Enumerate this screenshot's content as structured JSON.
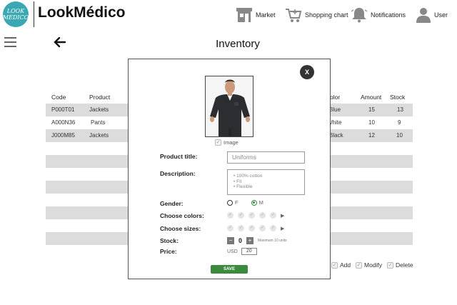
{
  "brand": {
    "logo_line1": "LOOK",
    "logo_line2": "MEDICO",
    "name": "LookMédico"
  },
  "nav": {
    "market": "Market",
    "cart": "Shopping chart",
    "notifications": "Notifications",
    "user": "User"
  },
  "page": {
    "title": "Inventory"
  },
  "table": {
    "headers": {
      "code": "Code",
      "product": "Product",
      "color": "olor",
      "amount": "Amount",
      "stock": "Stock"
    },
    "rows": [
      {
        "code": "P000T01",
        "product": "Jackets",
        "color": "Blue",
        "amount": "15",
        "stock": "13"
      },
      {
        "code": "A000N36",
        "product": "Pants",
        "color": "White",
        "amount": "10",
        "stock": "9"
      },
      {
        "code": "J000M85",
        "product": "Jackets",
        "color": "Black",
        "amount": "12",
        "stock": "10"
      }
    ]
  },
  "actions": {
    "add": "Add",
    "modify": "Modify",
    "delete": "Delete"
  },
  "modal": {
    "close_label": "X",
    "image_caption": "Image",
    "product_title_label": "Product title:",
    "product_title_value": "Uniforms",
    "description_label": "Description:",
    "description_lines": [
      "100% cotton",
      "Fit",
      "Flexible"
    ],
    "gender_label": "Gender:",
    "gender_f": "F",
    "gender_m": "M",
    "colors_label": "Choose colors:",
    "sizes_label": "Choose sizes:",
    "stock_label": "Stock:",
    "stock_minus": "−",
    "stock_value": "0",
    "stock_plus": "+",
    "stock_hint": "Maximum 10 units",
    "price_label": "Price:",
    "price_currency": "USD",
    "price_value": "20",
    "save_label": "SAVE"
  },
  "colors": {
    "accent_teal": "#3aa8b3",
    "save_green": "#3b8a3e",
    "row_shade": "#dcdcdc"
  },
  "icons": [
    "market-icon",
    "shopping-cart-icon",
    "bell-icon",
    "user-icon",
    "hamburger-menu-icon",
    "back-arrow-icon",
    "close-icon"
  ]
}
